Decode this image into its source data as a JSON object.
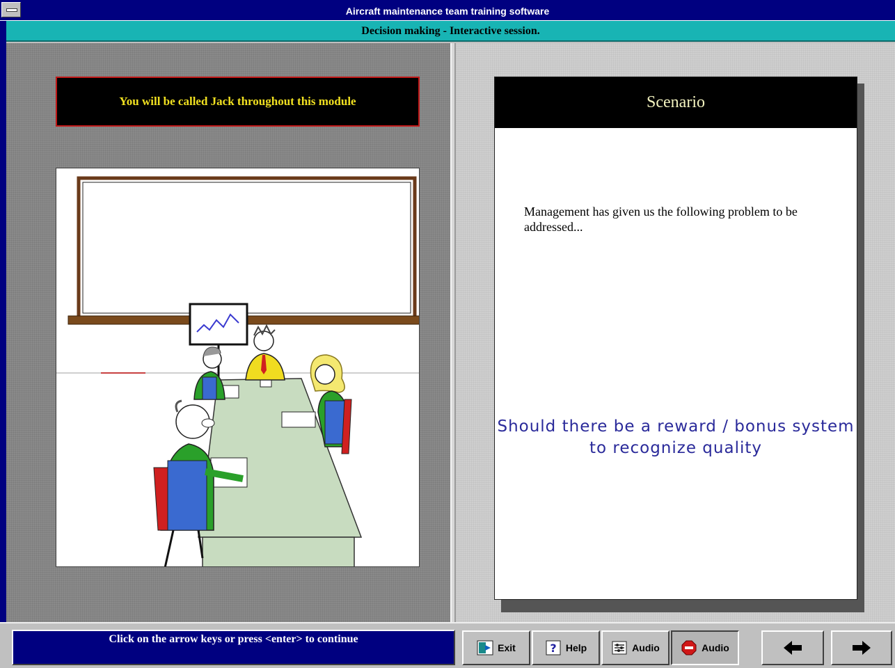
{
  "window": {
    "title": "Aircraft maintenance team training software",
    "subtitle": "Decision making - Interactive session."
  },
  "left": {
    "name_notice": "You will be called Jack throughout this module",
    "illustration": "meeting-room-cartoon"
  },
  "scenario": {
    "header": "Scenario",
    "intro": "Management has given us the following problem to be addressed...",
    "question": "Should there be a reward / bonus system to recognize quality"
  },
  "footer": {
    "hint": "Click on the arrow keys or press <enter> to continue",
    "buttons": {
      "exit": "Exit",
      "help": "Help",
      "audio_play": "Audio",
      "audio_stop": "Audio"
    }
  },
  "colors": {
    "title_bar": "#000080",
    "sub_bar": "#18b4b4",
    "name_text": "#f0e020",
    "question_text": "#2a2a9a"
  }
}
